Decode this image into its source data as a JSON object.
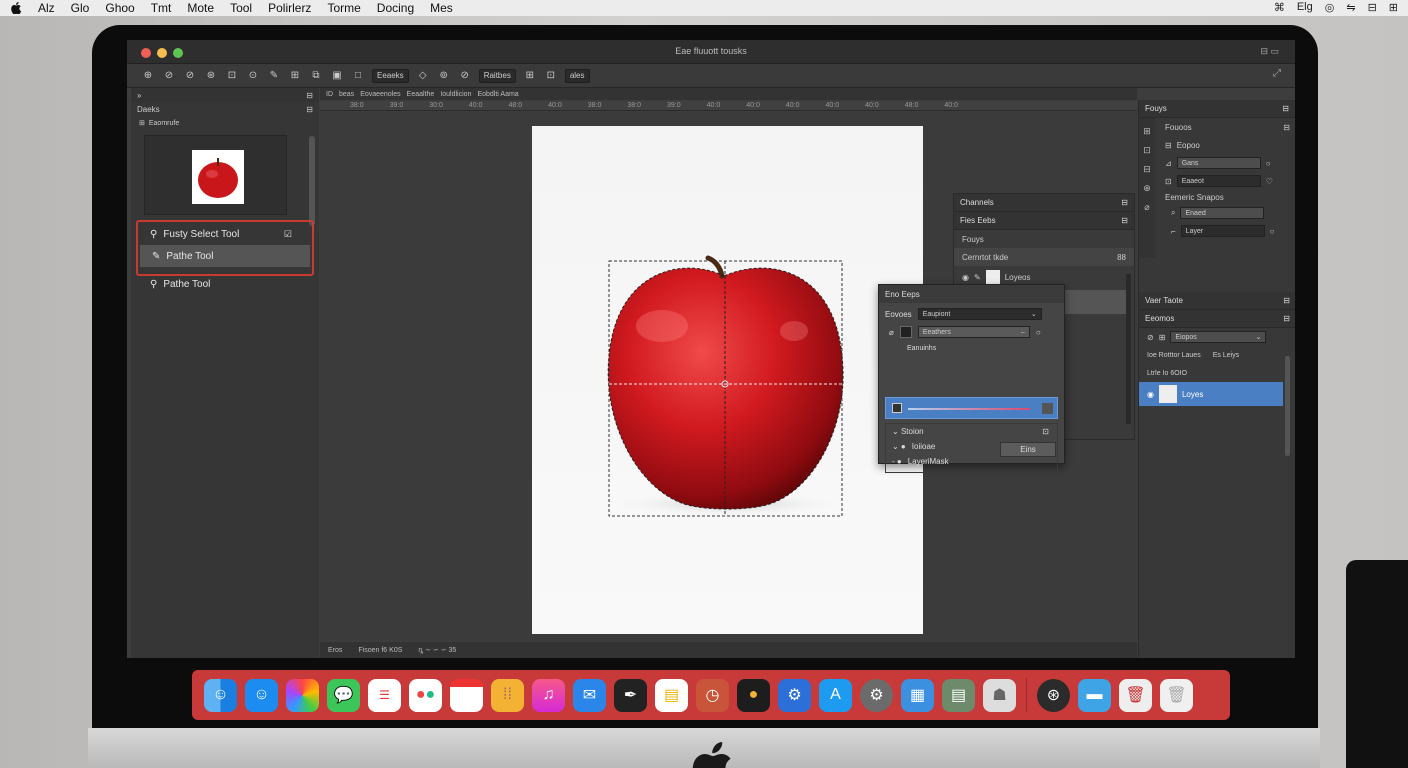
{
  "menubar": {
    "items": [
      "Alz",
      "Glo",
      "Ghoo",
      "Tmt",
      "Mote",
      "Tool",
      "Polirlerz",
      "Torme",
      "Docing",
      "Mes"
    ],
    "status_icons": [
      "⌘",
      "Elg",
      "◎",
      "⇋",
      "⊟",
      "⊞"
    ]
  },
  "window": {
    "title": "Eae fluuott tousks"
  },
  "options_bar": {
    "field1": "Eeaeks",
    "field2": "Raitbes",
    "field3": "ales"
  },
  "left_panel": {
    "header": "Daeks",
    "navigator_label": "Eaomrufe",
    "tools": [
      {
        "label": "Fusty Select Tool"
      },
      {
        "label": "Pathe Tool"
      },
      {
        "label": "Pathe Tool"
      }
    ]
  },
  "tabs_bar": {
    "tabs": [
      "ID",
      "beas",
      "Eovaeenoles",
      "Eeaalthe",
      "Iouldlicion",
      "Eobdlti Aama"
    ]
  },
  "ruler": {
    "ticks": [
      "38:0",
      "39:0",
      "30:0",
      "40:0",
      "48:0",
      "40:0",
      "38:0",
      "38:0",
      "39:0",
      "40:0",
      "40:0",
      "40:0",
      "40:0",
      "40:0",
      "48:0",
      "40:0"
    ]
  },
  "status_bar": {
    "items": [
      "Eros",
      "Fisoen f6 K0S",
      "ȵ ∼ ∽ ∽ 35"
    ]
  },
  "channels_panel": {
    "tab1": "Channels",
    "tab2": "Fies  Eebs",
    "section": "Fouys",
    "row1": "Cernrtot tkde",
    "row1_extra": "88",
    "row2": "Loyeos"
  },
  "props_dialog": {
    "title": "Eno  Eeps",
    "label1": "Eovoes",
    "select1": "Eaupiont",
    "select2": "Eeathers",
    "sub_label": "Eanuinhs",
    "list": [
      "Stoion",
      "Ioiioae",
      "LayeriMask"
    ],
    "button": "Eins"
  },
  "right_panel": {
    "header": "Fouys",
    "sub_header": "Fouoos",
    "rows": [
      "Eopoo",
      "Gans",
      "Eaaeot"
    ],
    "group_label": "Eemeric Snapos",
    "group_rows": [
      "Enaed",
      "Layer"
    ],
    "section2": "Vaer Taote",
    "section3": "Eeomos",
    "field": "Eiopos",
    "layer_header": "Ioe Rotttor Laues",
    "layer_header_extra": "Es Leiys",
    "layer_row1": "Ltrle Io 6OIO",
    "layer_row2": "Loyes"
  },
  "dock": {
    "apps": [
      "finder-icon",
      "safari-icon",
      "photos-icon",
      "messages-icon",
      "reminders-icon",
      "figma-icon",
      "calendar-icon",
      "notes-icon",
      "music-icon",
      "mail-icon",
      "quill-icon",
      "cards-icon",
      "clock-icon",
      "audio-icon",
      "tools-icon",
      "app-store-icon",
      "system-prefs-icon",
      "ios-app-icon",
      "scanner-icon",
      "utility-icon",
      "steam-icon",
      "folder-icon",
      "trash-full-icon",
      "trash-icon"
    ]
  },
  "colors": {
    "dock": "#c83a3a",
    "highlight": "#c93b32",
    "selection": "#4a7fc4"
  }
}
